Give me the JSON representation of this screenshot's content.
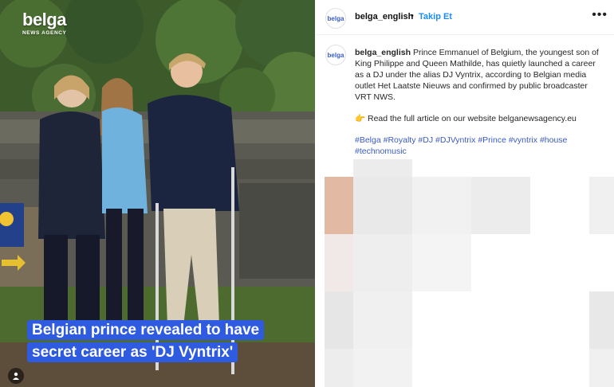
{
  "photo": {
    "logo_word": "belga",
    "logo_sub": "NEWS AGENCY",
    "headline_line1": "Belgian prince revealed to have",
    "headline_line2": "secret career as 'DJ Vyntrix'"
  },
  "header": {
    "avatar_text": "belga",
    "username": "belga_english",
    "separator": "•",
    "follow_label": "Takip Et",
    "more_label": "•••"
  },
  "caption": {
    "avatar_text": "belga",
    "username": "belga_english",
    "body": "Prince Emmanuel of Belgium, the youngest son of King Philippe and Queen Mathilde, has quietly launched a career as a DJ under the alias DJ Vyntrix, according to Belgian media outlet Het Laatste Nieuws and confirmed by public broadcaster VRT NWS.",
    "link_line": "👉 Read the full article on our website belganewsagency.eu",
    "hashtags": [
      "#Belga",
      "#Royalty",
      "#DJ",
      "#DJVyntrix",
      "#Prince",
      "#vyntrix",
      "#house",
      "#technomusic"
    ]
  },
  "colors": {
    "headline_bg": "#2f5be0",
    "follow": "#1a8cff",
    "hashtag": "#3b5bc8"
  }
}
